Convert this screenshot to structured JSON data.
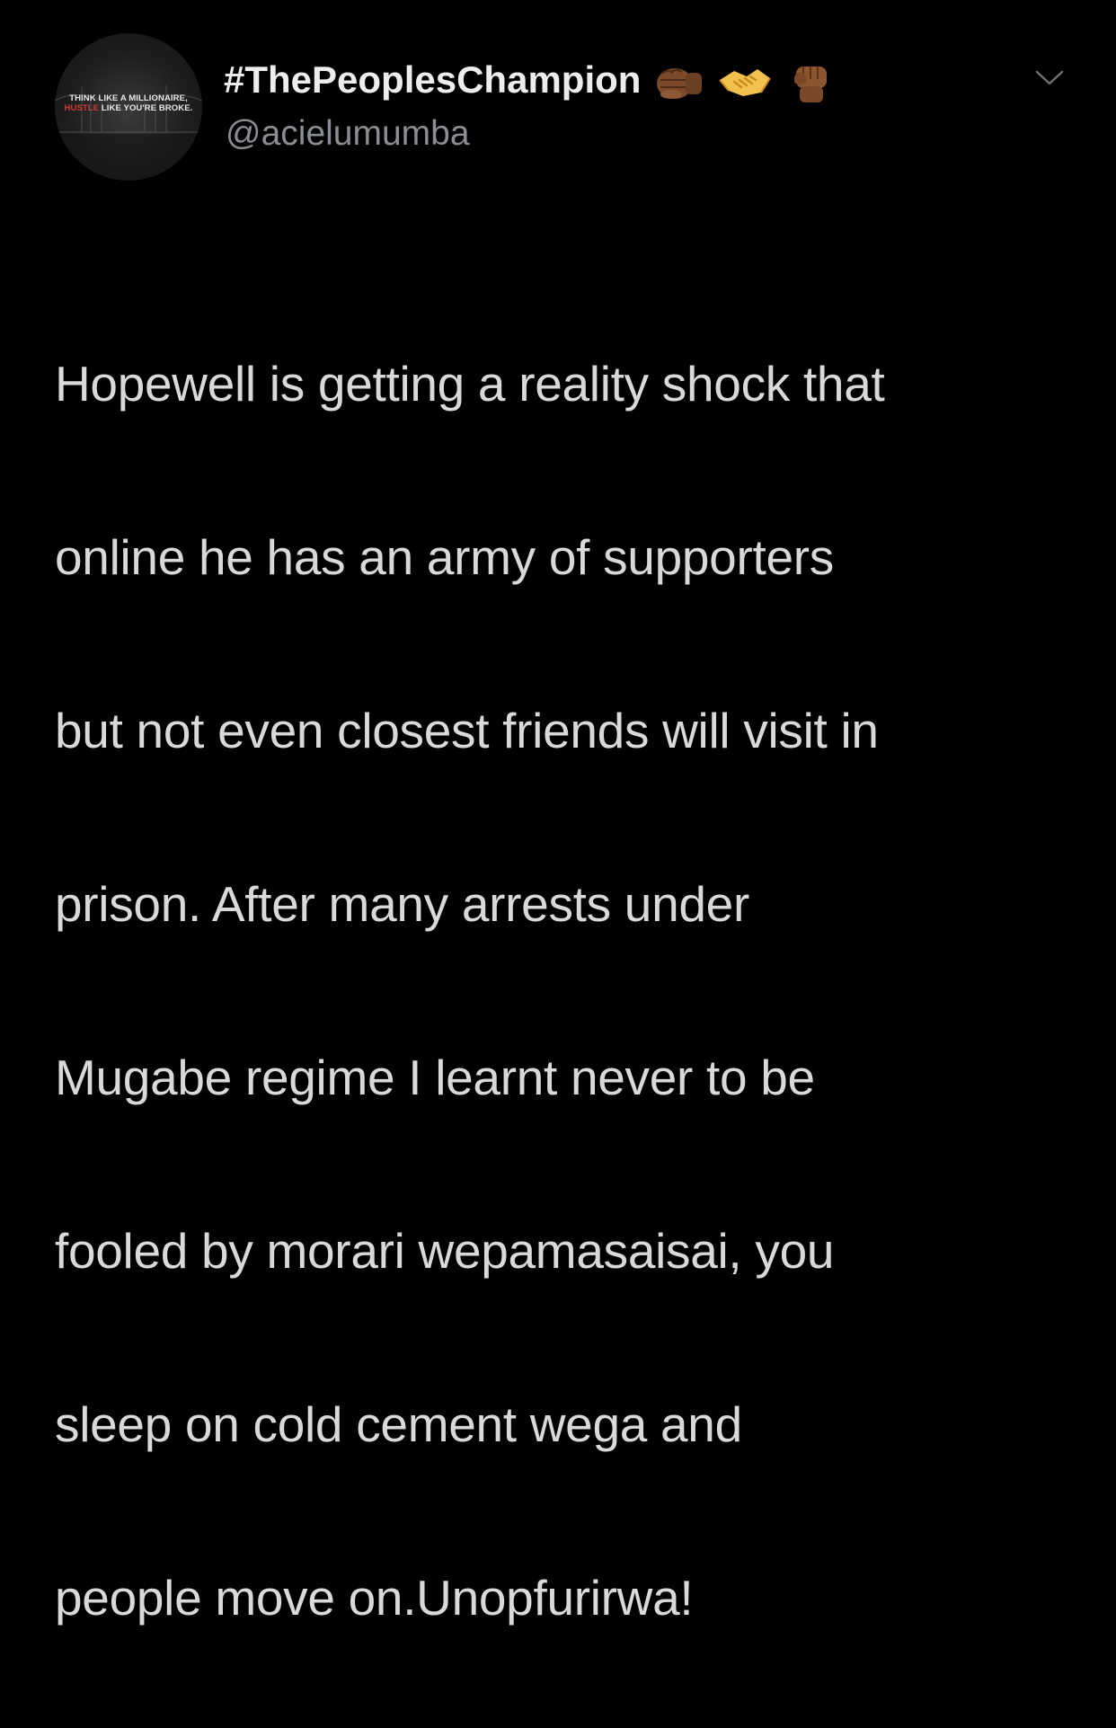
{
  "tweet": {
    "avatar": {
      "line1": "THINK LIKE A MILLIONAIRE,",
      "line2_highlight": "HUSTLE",
      "line2_rest": " LIKE YOU'RE BROKE.",
      "highlight_color": "#d23a3a"
    },
    "display_name": "#ThePeoplesChampion",
    "name_emojis": [
      "fist-bump-emoji",
      "handshake-emoji",
      "raised-fist-emoji"
    ],
    "handle": "@acielumumba",
    "more_icon": "chevron-down-icon",
    "body_lines": [
      "Hopewell is getting a reality shock that",
      "online he has an army of supporters",
      "but not even closest friends will visit in",
      "prison. After many arrests under",
      "Mugabe regime I learnt never to be",
      "fooled by morari wepamasaisai, you",
      "sleep on cold cement wega and",
      "people move on.Unopfurirwa!"
    ]
  },
  "colors": {
    "background": "#000000",
    "text_primary": "#d9d9d9",
    "text_secondary": "#8a8d91"
  }
}
